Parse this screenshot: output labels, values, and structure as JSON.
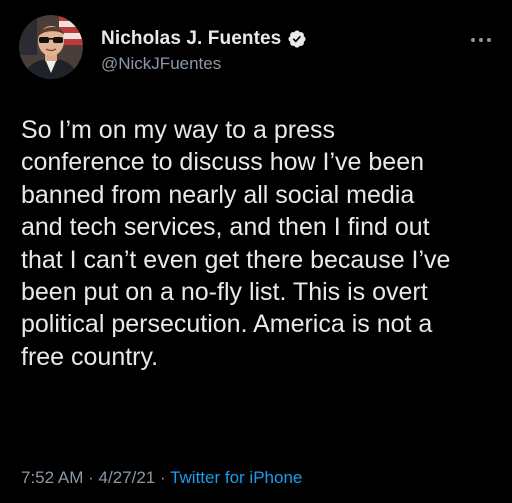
{
  "colors": {
    "background": "#000000",
    "text_primary": "#e7e9ea",
    "text_secondary": "#8b98a5",
    "link": "#1d9bf0",
    "verified_badge": "#e7e9ea"
  },
  "author": {
    "display_name": "Nicholas J. Fuentes",
    "handle": "@NickJFuentes",
    "verified": true,
    "verified_icon": "verified-badge-icon",
    "avatar_icon": "profile-photo"
  },
  "menu": {
    "icon": "more-horizontal-icon"
  },
  "tweet": {
    "text": "So I’m on my way to a press\nconference to discuss how I’ve been\nbanned from nearly all social media\nand tech services, and then I find out\nthat I can’t even get there because I’ve\nbeen put on a no-fly list. This is overt\npolitical persecution. America is not a\nfree country.",
    "time": "7:52 AM",
    "date": "4/27/21",
    "separator": "·",
    "source": "Twitter for iPhone"
  }
}
